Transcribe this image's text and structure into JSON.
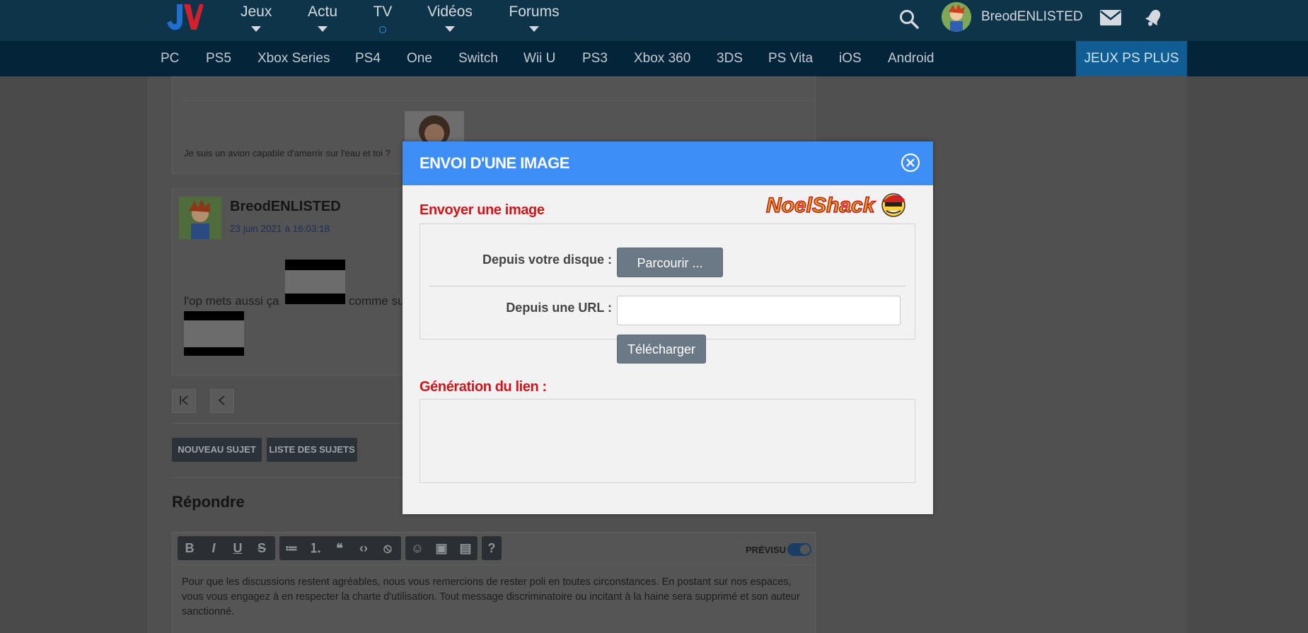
{
  "topbar": {
    "nav": [
      {
        "label": "Jeux",
        "marker": "caret"
      },
      {
        "label": "Actu",
        "marker": "caret"
      },
      {
        "label": "TV",
        "marker": "dot"
      },
      {
        "label": "Vidéos",
        "marker": "caret"
      },
      {
        "label": "Forums",
        "marker": "caret"
      }
    ],
    "username": "BreodENLISTED",
    "icons": [
      "search-icon",
      "mail-icon",
      "bell-icon"
    ]
  },
  "platforms": {
    "items": [
      "PC",
      "PS5",
      "Xbox Series",
      "PS4",
      "One",
      "Switch",
      "Wii U",
      "PS3",
      "Xbox 360",
      "3DS",
      "PS Vita",
      "iOS",
      "Android"
    ],
    "highlight": "JEUX PS PLUS"
  },
  "background": {
    "prev_post_text": "Je suis un avion capable d'amerrir sur l'eau et toi ?",
    "post": {
      "author": "BreodENLISTED",
      "date": "23 juin 2021 à 16:03:18",
      "text_start": "l'op mets aussi ça",
      "text_middle": "comme su"
    },
    "buttons": {
      "new_topic": "NOUVEAU SUJET",
      "topic_list": "LISTE DES SUJETS"
    },
    "reply_title": "Répondre",
    "editor": {
      "preview_label": "PRÉVISU",
      "placeholder": "Pour que les discussions restent agréables, nous vous remercions de rester poli en toutes circonstances. En postant sur nos espaces, vous vous engagez à en respecter la charte d'utilisation. Tout message discriminatoire ou incitant à la haine sera supprimé et son auteur sanctionné.",
      "toolbar": [
        "B",
        "I",
        "U",
        "S",
        "≔",
        "⒈",
        "❝",
        "‹›",
        "⦸",
        "☺",
        "▣",
        "▤",
        "?"
      ]
    }
  },
  "modal": {
    "title": "ENVOI D'UNE IMAGE",
    "logo_text": "NoelShack",
    "upload_section_title": "Envoyer une image",
    "disk_label": "Depuis votre disque :",
    "browse_button": "Parcourir ...",
    "url_label": "Depuis une URL :",
    "url_value": "",
    "upload_button": "Télécharger",
    "link_section_title": "Génération du lien :"
  },
  "colors": {
    "topbar": "#0d3449",
    "platbar": "#04243a",
    "modal_header": "#3e8ef7",
    "section_title": "#d0141a",
    "button_grey": "#6b7987"
  }
}
